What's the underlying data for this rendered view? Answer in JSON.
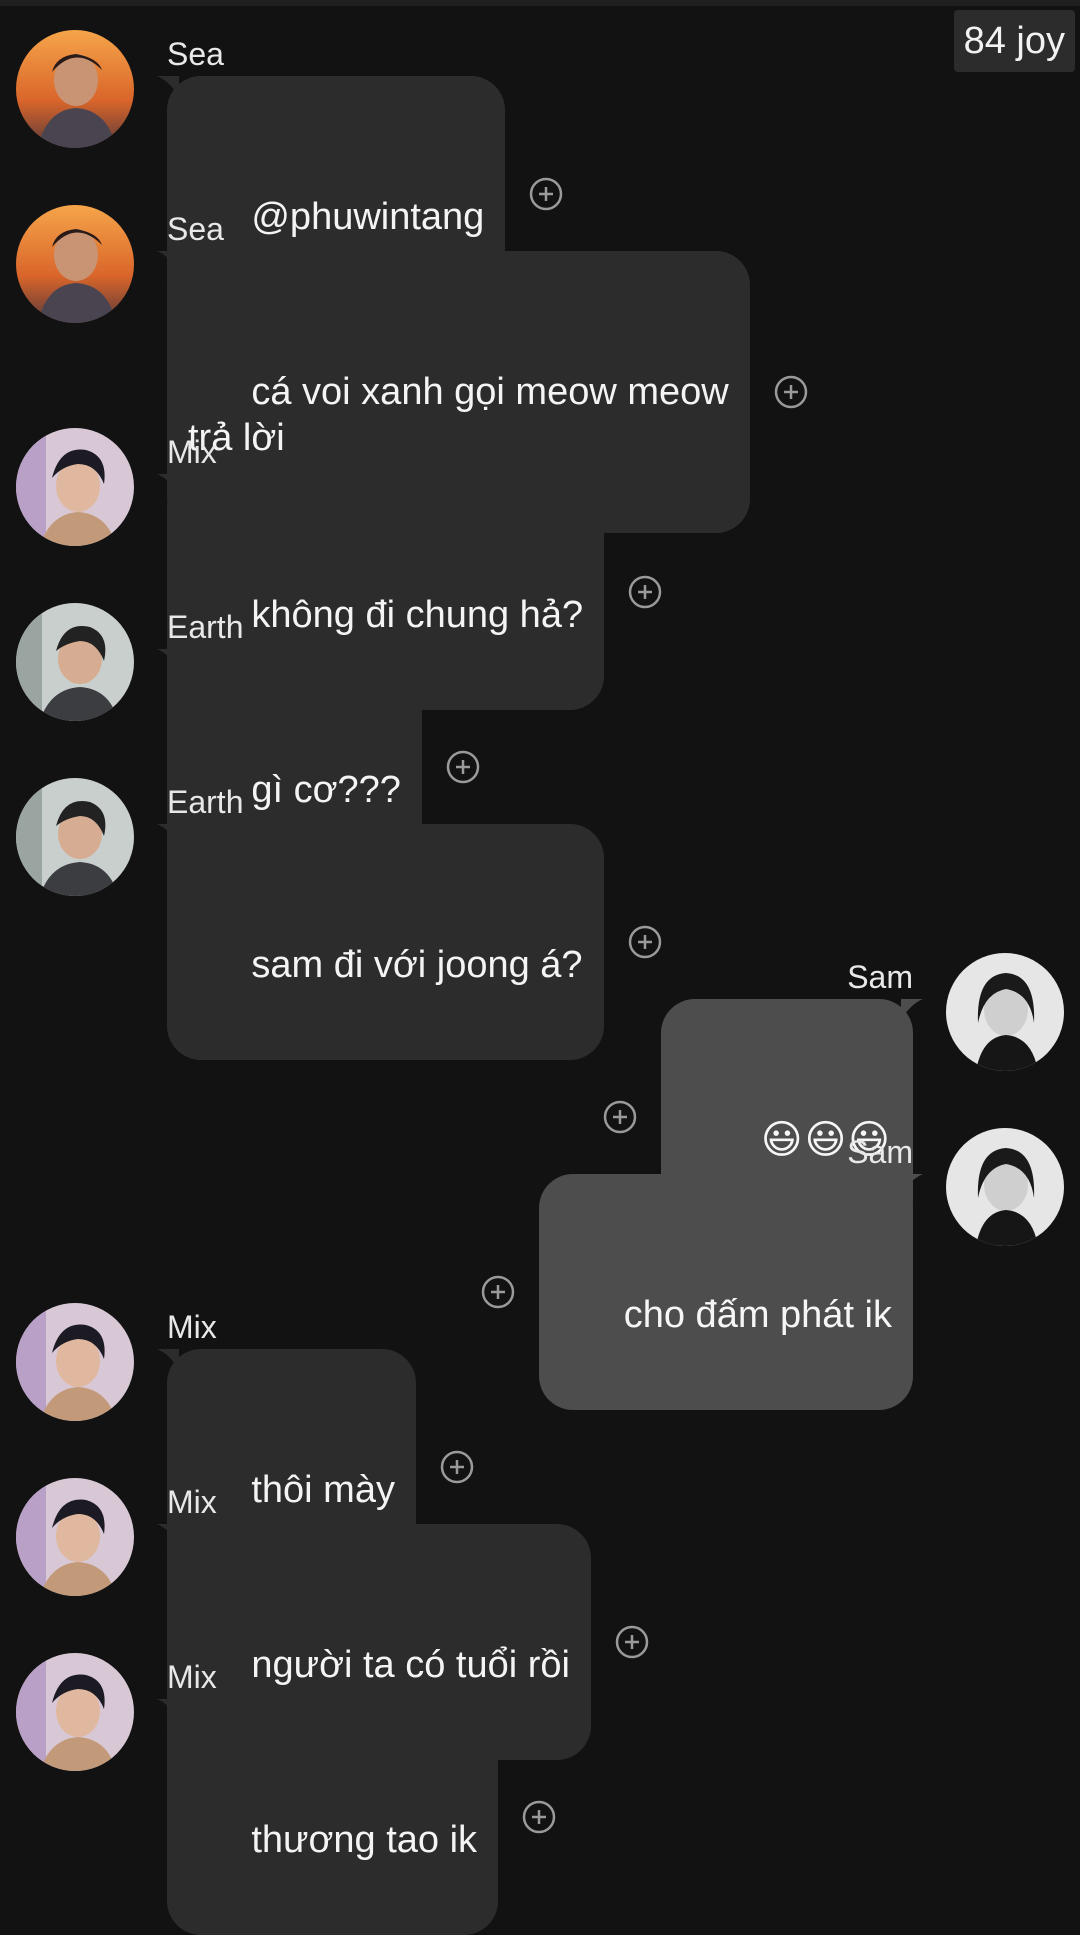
{
  "header": {
    "counter": "84 joy"
  },
  "icons": {
    "reaction": "add-reaction-icon"
  },
  "colors": {
    "background": "#121212",
    "incoming_bubble": "#2c2c2c",
    "outgoing_bubble": "#4d4d4d",
    "text": "#f4f4f4"
  },
  "messages": [
    {
      "sender": "Sea",
      "text": "@phuwintang",
      "side": "left"
    },
    {
      "sender": "Sea",
      "text": "cá voi xanh gọi meow meow\ntrả lời",
      "side": "left"
    },
    {
      "sender": "Mix",
      "text": "không đi chung hả?",
      "side": "left"
    },
    {
      "sender": "Earth",
      "text": "gì cơ???",
      "side": "left"
    },
    {
      "sender": "Earth",
      "text": "sam đi với joong á?",
      "side": "left"
    },
    {
      "sender": "Sam",
      "text": "😃😃😃",
      "side": "right"
    },
    {
      "sender": "Sam",
      "text": "cho đấm phát ik",
      "side": "right"
    },
    {
      "sender": "Mix",
      "text": "thôi mày",
      "side": "left"
    },
    {
      "sender": "Mix",
      "text": "người ta có tuổi rồi",
      "side": "left"
    },
    {
      "sender": "Mix",
      "text": "thương tao ik",
      "side": "left"
    }
  ]
}
